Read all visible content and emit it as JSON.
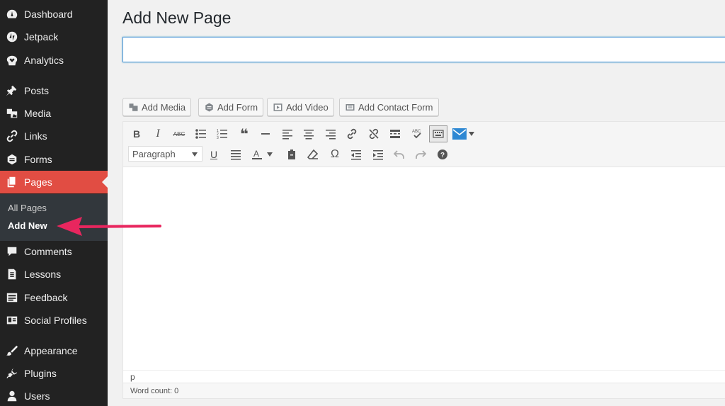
{
  "sidebar": {
    "items": [
      {
        "label": "Dashboard",
        "icon": "dashboard-icon"
      },
      {
        "label": "Jetpack",
        "icon": "jetpack-icon"
      },
      {
        "label": "Analytics",
        "icon": "analytics-icon"
      },
      {
        "label": "Posts",
        "icon": "pin-icon"
      },
      {
        "label": "Media",
        "icon": "media-icon"
      },
      {
        "label": "Links",
        "icon": "link-icon"
      },
      {
        "label": "Forms",
        "icon": "forms-icon"
      },
      {
        "label": "Pages",
        "icon": "pages-icon"
      },
      {
        "label": "Comments",
        "icon": "comment-icon"
      },
      {
        "label": "Lessons",
        "icon": "lessons-icon"
      },
      {
        "label": "Feedback",
        "icon": "feedback-icon"
      },
      {
        "label": "Social Profiles",
        "icon": "id-card-icon"
      },
      {
        "label": "Appearance",
        "icon": "brush-icon"
      },
      {
        "label": "Plugins",
        "icon": "plugin-icon"
      },
      {
        "label": "Users",
        "icon": "user-icon"
      }
    ],
    "active_item": "Pages",
    "submenu": {
      "all_pages": "All Pages",
      "add_new": "Add New"
    }
  },
  "main": {
    "page_title": "Add New Page",
    "title_input_value": "",
    "media_buttons": [
      {
        "label": "Add Media",
        "icon": "media-icon"
      },
      {
        "label": "Add Form",
        "icon": "forms-icon"
      },
      {
        "label": "Add Video",
        "icon": "video-icon"
      },
      {
        "label": "Add Contact Form",
        "icon": "contact-form-icon"
      }
    ],
    "editor": {
      "format_select_value": "Paragraph",
      "path_text": "p",
      "word_count_text": "Word count: 0"
    }
  },
  "colors": {
    "sidebar_bg": "#222222",
    "active_menu": "#e14d43",
    "submenu_bg": "#32373c",
    "arrow": "#e8265e"
  }
}
